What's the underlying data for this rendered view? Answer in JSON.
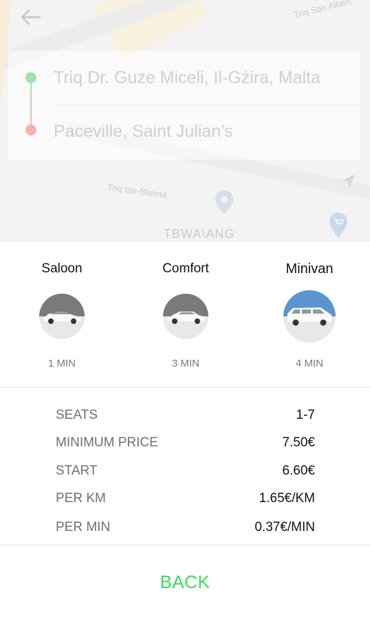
{
  "map": {
    "street_labels": [
      "Triq San Albert",
      "Triq tas-Sliema",
      "TBWA\\ANG"
    ],
    "route": {
      "origin": "Triq Dr. Guze Miceli, Il-Gżira, Malta",
      "destination": "Paceville, Saint Julian’s"
    }
  },
  "vehicles": [
    {
      "name": "Saloon",
      "eta": "1 MIN",
      "selected": false
    },
    {
      "name": "Comfort",
      "eta": "3 MIN",
      "selected": false
    },
    {
      "name": "Minivan",
      "eta": "4 MIN",
      "selected": true
    }
  ],
  "details": [
    {
      "label": "SEATS",
      "value": "1-7"
    },
    {
      "label": "MINIMUM PRICE",
      "value": "7.50€"
    },
    {
      "label": "START",
      "value": "6.60€"
    },
    {
      "label": "PER KM",
      "value": "1.65€/KM"
    },
    {
      "label": "PER MIN",
      "value": "0.37€/MIN"
    }
  ],
  "back_button": "BACK",
  "colors": {
    "accent_green": "#3ddc5e",
    "origin_dot": "#9fe3b0",
    "destination_dot": "#f3b3b3",
    "selected_vehicle_sky": "#5b95cf"
  },
  "icons": {
    "back": "arrow-left-icon",
    "vehicle": "car-icon",
    "map_pin": "map-pin-icon",
    "shop_pin": "shopping-cart-pin-icon",
    "location": "navigation-arrow-icon"
  }
}
